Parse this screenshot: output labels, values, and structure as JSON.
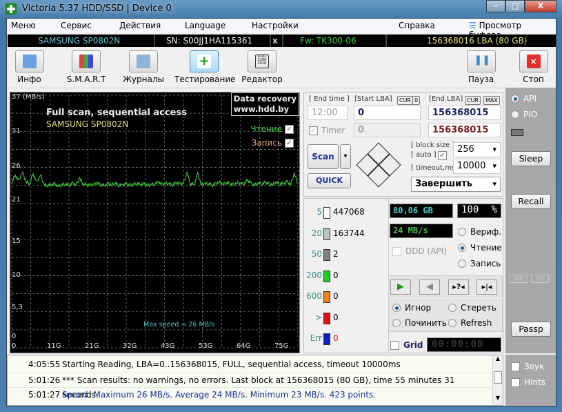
{
  "window": {
    "title": "Victoria 5.37 HDD/SSD | Device 0",
    "minimize": "–",
    "maximize": "□",
    "close": "X"
  },
  "menu": [
    "Меню",
    "Сервис",
    "Действия",
    "Language",
    "Настройки",
    "Справка",
    "Просмотр буфера"
  ],
  "drive": {
    "model": "SAMSUNG SP0802N",
    "serial": "SN: S00JJ1HA115361",
    "close": "x",
    "firmware": "Fw: TK300-06",
    "capacity": "156368016 LBA (80 GB)"
  },
  "toolbar": [
    "Инфо",
    "S.M.A.R.T",
    "Журналы",
    "Тестирование",
    "Редактор",
    "Пауза",
    "Стоп"
  ],
  "graph": {
    "title": "Full scan, sequential access",
    "drive": "SAMSUNG SP0802N",
    "brand1": "Data recovery",
    "brand2": "www.hdd.by",
    "read_label": "Чтение",
    "write_label": "Запись",
    "max_speed": "Max speed = 26 MB/s"
  },
  "chart_data": {
    "type": "line",
    "ylabel": "(MB/s)",
    "ylim": [
      0,
      37
    ],
    "xlim": [
      0,
      80
    ],
    "yticks": [
      "37",
      "31",
      "26",
      "21",
      "15",
      "10",
      "5,3",
      "0"
    ],
    "ytick_values": [
      37,
      31,
      26,
      21,
      15,
      10,
      5.3,
      0
    ],
    "xticks": [
      "0",
      "11G",
      "21G",
      "32G",
      "43G",
      "53G",
      "64G",
      "75G"
    ],
    "xtick_values": [
      0,
      10.6,
      21.2,
      31.8,
      42.4,
      53,
      63.6,
      74.2
    ],
    "grid": true,
    "series": [
      {
        "name": "Чтение",
        "color": "#3fd43f",
        "x_unit": "GB",
        "values": [
          24.2,
          25.3,
          24.4,
          25.8,
          24.3,
          24.1,
          25.5,
          24.2,
          25.4,
          23.9,
          23.8,
          23.9,
          24.0,
          23.7,
          23.9,
          24.0,
          23.8,
          24.1,
          23.9,
          24.8,
          24.0,
          23.9,
          23.8,
          24.0,
          24.1,
          23.9,
          23.8,
          24.0,
          23.9,
          24.1,
          23.8,
          23.9,
          24.0,
          23.8,
          23.9,
          24.1,
          23.9,
          24.0,
          23.8,
          23.9,
          24.0,
          24.3,
          23.9,
          24.1,
          24.0,
          23.9,
          24.2,
          24.0,
          24.1,
          25.6,
          24.0,
          23.9,
          25.5,
          23.9,
          24.0,
          24.1,
          23.8,
          24.0,
          24.3,
          23.9,
          24.2,
          24.0,
          23.9,
          24.2,
          24.0,
          24.1,
          24.6,
          24.0,
          23.9,
          24.1,
          24.0,
          24.3,
          23.9,
          24.0,
          24.2,
          24.0,
          24.1,
          24.3,
          24.0,
          25.5,
          24.0
        ]
      }
    ]
  },
  "control": {
    "end_time_label": "[ End time ]",
    "end_time": "12:00",
    "start_lba_label": "[Start LBA]",
    "cur": "CUR",
    "zero": "0",
    "end_lba_label": "[End LBA]",
    "max": "MAX",
    "start_lba": "0",
    "end_lba": "156368015",
    "timer_label": "Timer",
    "timer_start": "0",
    "timer_end": "156368015",
    "scan": "Scan",
    "quick": "QUICK",
    "block_size_label": "[ block size ]",
    "auto_label": "[ auto ]",
    "block_size": "256",
    "timeout_label": "[ timeout,ms ]",
    "timeout": "10000",
    "finish": "Завершить"
  },
  "legend": [
    {
      "ms": "5",
      "count": "447068",
      "color": "#ffffff"
    },
    {
      "ms": "20",
      "count": "163744",
      "color": "#c0c0c0"
    },
    {
      "ms": "50",
      "count": "2",
      "color": "#808080"
    },
    {
      "ms": "200",
      "count": "0",
      "color": "#22cc22"
    },
    {
      "ms": "600",
      "count": "0",
      "color": "#f08020"
    },
    {
      "ms": ">",
      "count": "0",
      "color": "#e01010"
    },
    {
      "ms": "Err",
      "count": "0",
      "color": "#1020c0"
    }
  ],
  "status": {
    "size": "80,06 GB",
    "percent": "100",
    "percent_sign": "%",
    "speed": "24 MB/s",
    "ddd": "DDD (API)",
    "timer": "00:00:00"
  },
  "mode": {
    "verify": "Вериф.",
    "read": "Чтение",
    "write": "Запись"
  },
  "action": {
    "ignore": "Игнор",
    "erase": "Стереть",
    "repair": "Починить",
    "refresh": "Refresh"
  },
  "grid_label": "Grid",
  "side": {
    "api": "API",
    "pio": "PIO",
    "sleep": "Sleep",
    "recall": "Recall",
    "wr": "WR",
    "rd": "RD",
    "passp": "Passp",
    "sound": "Звук",
    "hints": "Hints"
  },
  "log": [
    {
      "time": "4:05:55",
      "msg": "Starting Reading, LBA=0..156368015, FULL, sequential access, timeout 10000ms",
      "color": "#000000"
    },
    {
      "time": "5:01:26",
      "msg": "*** Scan results: no warnings, no errors. Last block at 156368015 (80 GB), time 55 minutes 31 seconds.",
      "color": "#000000"
    },
    {
      "time": "5:01:27",
      "msg": "Speed: Maximum 26 MB/s. Average 24 MB/s. Minimum 23 MB/s. 423 points.",
      "color": "#1a2fa0"
    }
  ]
}
